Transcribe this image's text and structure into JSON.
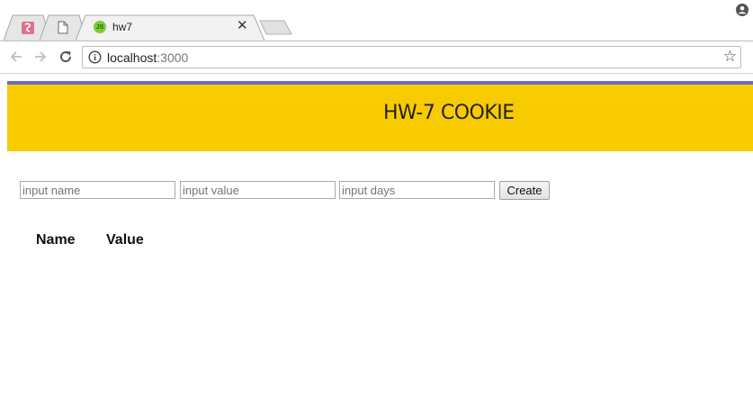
{
  "browser": {
    "tabs": [
      {
        "label": "",
        "icon": "ruby-gem-icon"
      },
      {
        "label": "",
        "icon": "document-icon"
      },
      {
        "label": "hw7",
        "icon": "nodejs-icon",
        "active": true
      }
    ],
    "favicon_text": "JS",
    "close_glyph": "✕",
    "url_host": "localhost",
    "url_port": ":3000",
    "bookmark_glyph": "☆"
  },
  "page": {
    "title": "HW-7 COOKIE",
    "colors": {
      "banner": "#f7cb00",
      "accent": "#6b6bc4"
    },
    "form": {
      "name_placeholder": "input name",
      "value_placeholder": "input value",
      "days_placeholder": "input days",
      "create_label": "Create"
    },
    "table": {
      "headers": [
        "Name",
        "Value"
      ]
    }
  }
}
